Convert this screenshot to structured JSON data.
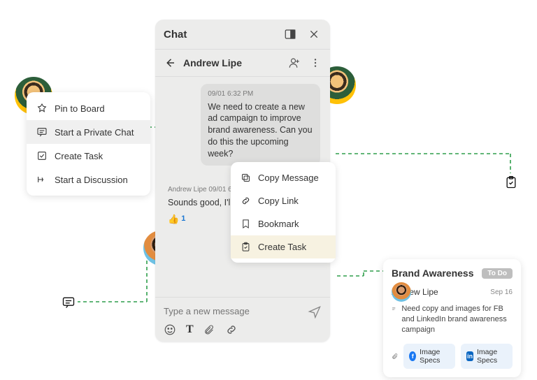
{
  "chat": {
    "title": "Chat",
    "contact": "Andrew Lipe",
    "msg1_ts": "09/01 6:32 PM",
    "msg1_body": "We need to create a new ad campaign to improve brand awareness. Can you do this the upcoming week?",
    "msg2_au": "Andrew Lipe  09/01 6:33 PM",
    "msg2_body": "Sounds good, I'll do that!",
    "thumb_count": "1",
    "compose_placeholder": "Type a new message"
  },
  "user_menu": {
    "pin": "Pin to Board",
    "chat": "Start a Private Chat",
    "task": "Create Task",
    "disc": "Start a Discussion"
  },
  "msg_menu": {
    "copy_msg": "Copy Message",
    "copy_link": "Copy Link",
    "bookmark": "Bookmark",
    "create_task": "Create Task"
  },
  "task": {
    "title": "Brand Awareness",
    "status": "To Do",
    "assignee": "Andrew Lipe",
    "due": "Sep 16",
    "desc": "Need copy and images for FB and LinkedIn brand awareness campaign",
    "att1": "Image Specs",
    "att2": "Image Specs"
  }
}
